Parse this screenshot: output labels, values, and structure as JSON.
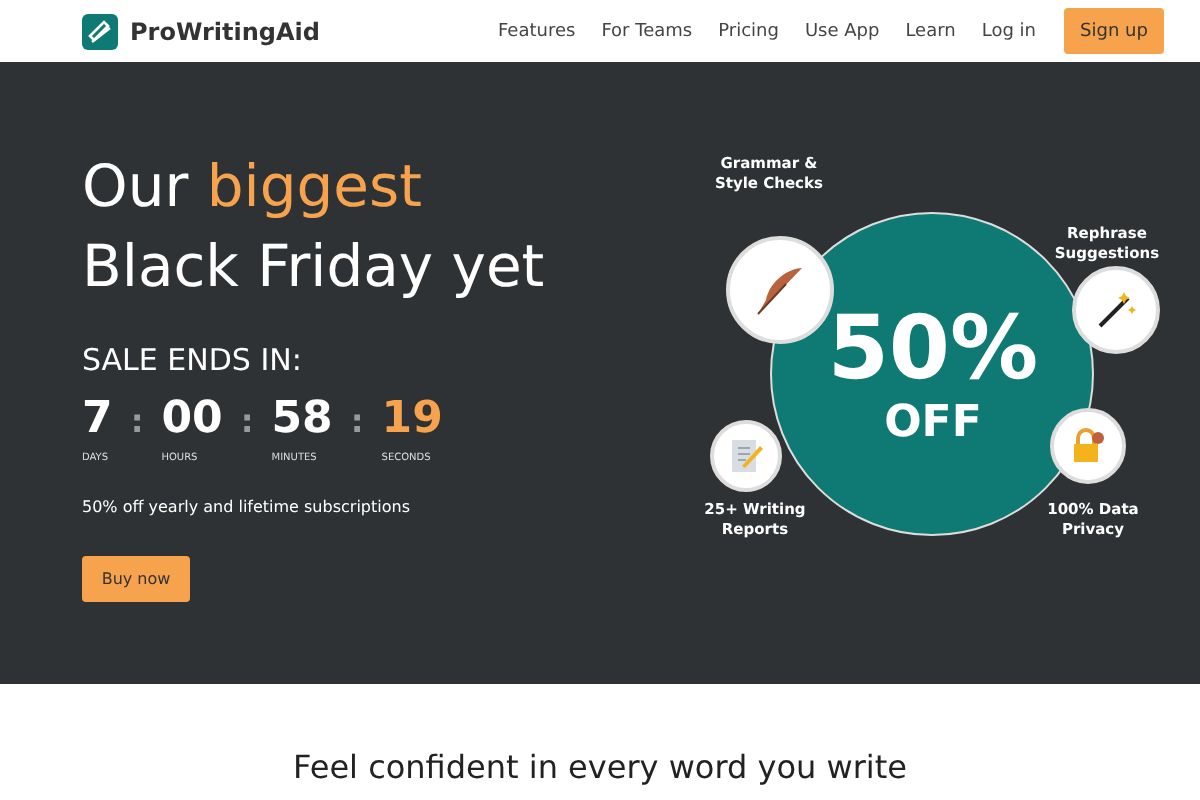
{
  "nav": {
    "brand": "ProWritingAid",
    "links": [
      "Features",
      "For Teams",
      "Pricing",
      "Use App",
      "Learn",
      "Log in"
    ],
    "cta": "Sign up"
  },
  "hero": {
    "headline": {
      "line_1": "Our",
      "highlight": "biggest",
      "line_2": "Black Friday yet"
    },
    "sale_label": "SALE ENDS IN:",
    "countdown": [
      {
        "value": "7",
        "unit": "DAYS",
        "highlight": false
      },
      {
        "value": "00",
        "unit": "HOURS",
        "highlight": false
      },
      {
        "value": "58",
        "unit": "MINUTES",
        "highlight": false
      },
      {
        "value": "19",
        "unit": "SECONDS",
        "highlight": true
      }
    ],
    "separator": ":",
    "subtitle": "50% off yearly and lifetime subscriptions",
    "button": "Buy now",
    "badge": {
      "amount": "50%",
      "word": "OFF"
    },
    "features": [
      {
        "kind": "feather",
        "label": "Grammar &\nStyle Checks"
      },
      {
        "kind": "wand",
        "label": "Rephrase\nSuggestions"
      },
      {
        "kind": "report",
        "label": "25+ Writing\nReports"
      },
      {
        "kind": "lock",
        "label": "100% Data\nPrivacy"
      }
    ]
  },
  "section_title": "Feel confident in every word you write"
}
